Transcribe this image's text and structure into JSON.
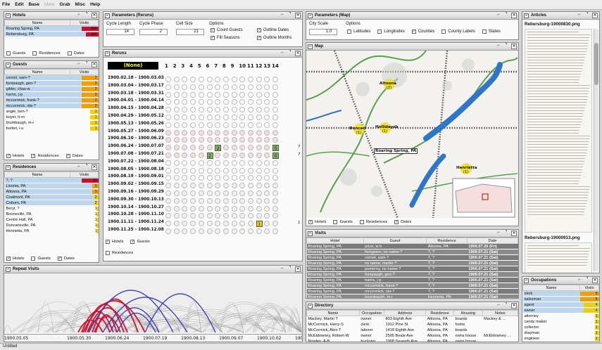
{
  "menu": [
    {
      "label": "File",
      "enabled": true
    },
    {
      "label": "Edit",
      "enabled": true
    },
    {
      "label": "Base",
      "enabled": true
    },
    {
      "label": "Meta",
      "enabled": false
    },
    {
      "label": "Grab",
      "enabled": true
    },
    {
      "label": "Misc",
      "enabled": true
    },
    {
      "label": "Help",
      "enabled": true
    }
  ],
  "status": "Untitled",
  "hotels": {
    "title": "Hotels",
    "cols": [
      "Name",
      "Visits"
    ],
    "rows": [
      {
        "name": "Roaring Spring, PA",
        "v": "800"
      },
      {
        "name": "Rebersburg, PA",
        "v": "580"
      }
    ],
    "checks": [
      "Guests",
      "Residences",
      "Dates"
    ]
  },
  "guests": {
    "title": "Guests",
    "cols": [
      "Name",
      "Visits"
    ],
    "rows": [
      {
        "name": "cornet, sam-?",
        "v": "2"
      },
      {
        "name": "forepaugh, geo-?",
        "v": "2"
      },
      {
        "name": "gilder, chas-w",
        "v": "2"
      },
      {
        "name": "harris, j-p",
        "v": "2"
      },
      {
        "name": "mccormick, frank-?",
        "v": "2"
      },
      {
        "name": "mccormick, ida-?",
        "v": "2"
      },
      {
        "name": "angle, ben-?",
        "v": "1"
      },
      {
        "name": "boyer, h-m",
        "v": "1"
      },
      {
        "name": "brumbaugh, m-r",
        "v": "1"
      },
      {
        "name": "burket, i-u",
        "v": "1"
      }
    ],
    "checks": [
      "Hotels",
      "Residences",
      "Dates"
    ]
  },
  "residences": {
    "title": "Residences",
    "cols": [
      "Name",
      "Visits"
    ],
    "rows": [
      {
        "name": "?, ?",
        "v": "33"
      },
      {
        "name": "Livonia, PA",
        "v": "3"
      },
      {
        "name": "Altoona, PA",
        "v": "3"
      },
      {
        "name": "Coalmont, PA",
        "v": "2"
      },
      {
        "name": "Coburn, PA",
        "v": "2"
      },
      {
        "name": "Beryl, ?",
        "v": "1"
      },
      {
        "name": "Booneville, PA",
        "v": "1"
      },
      {
        "name": "Centre Hall, PA",
        "v": "1"
      },
      {
        "name": "Duncansville, PA",
        "v": "1"
      },
      {
        "name": "Henrietta, PA",
        "v": "1"
      }
    ],
    "checks": [
      "Hotels",
      "Guests",
      "Dates"
    ]
  },
  "params_reruns": {
    "title": "Parameters (Reruns)",
    "labels": [
      "Cycle Length",
      "Cycle Phase",
      "Cell Size",
      "Options"
    ],
    "values": [
      "14",
      "2",
      "21"
    ],
    "options": [
      "Count Guests",
      "Outline Dates",
      "Fill Seasons",
      "Outline Months"
    ]
  },
  "reruns": {
    "title": "Reruns",
    "none_label": "(None)",
    "cols": [
      "1",
      "2",
      "3",
      "4",
      "5",
      "6",
      "7",
      "8",
      "9",
      "10",
      "11",
      "12",
      "13",
      "14"
    ],
    "rows": [
      "1900.02.18 - 1900.03.03",
      "1900.03.04 - 1900.03.17",
      "1900.03.18 - 1900.03.31",
      "1900.04.01 - 1900.04.14",
      "1900.04.15 - 1900.04.28",
      "1900.04.29 - 1900.05.12",
      "1900.05.13 - 1900.05.26",
      "1900.05.27 - 1900.06.09",
      "1900.06.10 - 1900.06.23",
      "1900.06.24 - 1900.07.07",
      "1900.07.08 - 1900.07.21",
      "1900.07.22 - 1900.08.04",
      "1900.08.05 - 1900.08.18",
      "1900.08.19 - 1900.09.01",
      "1900.09.02 - 1900.09.15",
      "1900.09.16 - 1900.09.29",
      "1900.09.30 - 1900.10.13",
      "1900.10.14 - 1900.10.27",
      "1900.10.28 - 1900.11.10",
      "1900.11.11 - 1900.11.24",
      "1900.11.25 - 1900.12.08"
    ],
    "side_counts": [
      "7",
      "7",
      "1"
    ],
    "checks": [
      "Hotels",
      "Guests",
      "Residences"
    ]
  },
  "params_map": {
    "title": "Parameters (Map)",
    "labels": [
      "City Scale",
      "Options"
    ],
    "scale": "1.0",
    "options": [
      "Latitudes",
      "Longitudes",
      "Counties",
      "County Labels",
      "States"
    ]
  },
  "map": {
    "title": "Map",
    "places": [
      {
        "name": "Altoona",
        "count": "(2)"
      },
      {
        "name": "Duncan",
        "count": "(1)"
      },
      {
        "name": "Hollidaysb",
        "count": "(1)"
      },
      {
        "name": "Roaring Spring, PA",
        "count": ""
      },
      {
        "name": "Henrietta",
        "count": "(1)"
      }
    ],
    "checks": [
      "Hotels",
      "Guests",
      "Residences",
      "Dates"
    ]
  },
  "visits": {
    "title": "Visits",
    "cols": [
      "Hotel",
      "Guest",
      "Residence",
      "Date"
    ],
    "rows": [
      {
        "h": "Roaring Spring, PA",
        "g": "price, w-h",
        "r": "Altoona, PA",
        "d": "1900.07.20 (Fri)"
      },
      {
        "h": "Roaring Spring, PA",
        "g": "livingston, no name-?",
        "r": "?, ?",
        "d": "1900.07.21 (Sat)"
      },
      {
        "h": "Roaring Spring, PA",
        "g": "cornet, sam-?",
        "r": "?, ?",
        "d": "1900.07.21 (Sat)"
      },
      {
        "h": "Roaring Spring, PA",
        "g": "no name, martin-?",
        "r": "?, ?",
        "d": "1900.07.21 (Sat)"
      },
      {
        "h": "Roaring Spring, PA",
        "g": "pomeroy, no name-?",
        "r": "?, ?",
        "d": "1900.07.21 (Sat)"
      },
      {
        "h": "Roaring Spring, PA",
        "g": "forepaugh, geo-?",
        "r": "?, ?",
        "d": "1900.07.21 (Sat)"
      },
      {
        "h": "Roaring Spring, PA",
        "g": "harris, j-p",
        "r": "?, ?",
        "d": "1900.07.21 (Sat)"
      },
      {
        "h": "Roaring Spring, PA",
        "g": "mccormick, frank-?",
        "r": "?, ?",
        "d": "1900.07.21 (Sat)"
      },
      {
        "h": "Roaring Spring, PA",
        "g": "mccormick, ida-?",
        "r": "?, ?",
        "d": "1900.07.21 (Sat)"
      },
      {
        "h": "Roaring Spring, PA",
        "g": "brumbaugh, m-r",
        "r": "Henrietta, PA",
        "d": "1900.07.21 (Sat)"
      }
    ]
  },
  "directory": {
    "title": "Directory",
    "cols": [
      "Name",
      "Occupation",
      "Address",
      "Residence",
      "Housing",
      "Notes"
    ],
    "rows": [
      {
        "n": "Mackey, Martin T",
        "o": "owner",
        "a": "803 Eighth Ave",
        "r": "Altoona, PA",
        "h": "boards",
        "x": "Mackey & ..."
      },
      {
        "n": "McCormick, Harry-S",
        "o": "clerk",
        "a": "1912 Pine St",
        "r": "Altoona, PA",
        "h": "home",
        "x": ""
      },
      {
        "n": "McCormick, Alex-T",
        "o": "laborer",
        "a": "1418 Eighth Ave",
        "r": "Altoona, PA",
        "h": "boards",
        "x": ""
      },
      {
        "n": "McEldowney, Robert-W",
        "o": "owner",
        "a": "2505 Beale Ave",
        "r": "Altoona, PA",
        "h": "owns house",
        "x": "McEldowney ..."
      },
      {
        "n": "Nowlen, A-B",
        "o": "huckster",
        "a": "1908 Seventh Ave",
        "r": "Altoona, PA",
        "h": "owns house",
        "x": ""
      }
    ]
  },
  "repeat": {
    "title": "Repeat Visits",
    "ticks": [
      "1900.05.05",
      "1900.05.30",
      "1900.06.24",
      "1900.07.19",
      "1900.08.13",
      "1900.09.07",
      "1900.10.02",
      "1900.10.27"
    ]
  },
  "articles": {
    "title": "Articles",
    "pages": [
      "Rebersburg-19000830.png",
      "Rebersburg-19000913.png"
    ]
  },
  "occupations": {
    "title": "Occupations",
    "cols": [
      "Name",
      "Visits"
    ],
    "rows": [
      {
        "n": "clerk",
        "v": "5"
      },
      {
        "n": "salesman",
        "v": "5"
      },
      {
        "n": "agent",
        "v": "4"
      },
      {
        "n": "owner",
        "v": "4"
      },
      {
        "n": "attorney",
        "v": "1"
      },
      {
        "n": "candy maker",
        "v": "1"
      },
      {
        "n": "collector",
        "v": "1"
      },
      {
        "n": "drayman",
        "v": "1"
      },
      {
        "n": "engineer",
        "v": "1"
      },
      {
        "n": "huckster",
        "v": "1"
      }
    ]
  },
  "colors": {
    "accent_red": "#c8102e",
    "accent_blue": "#3a3ab0",
    "select_blue": "#bcd6ee",
    "bar_yellow": "#f0d000",
    "bar_orange": "#f0a000",
    "visits_header_gray": "#7a7a7a"
  }
}
